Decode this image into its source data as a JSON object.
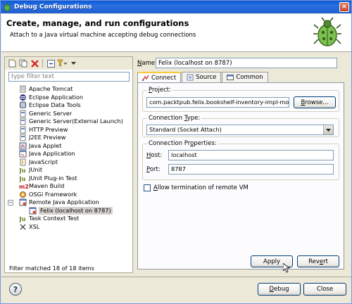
{
  "window": {
    "title": "Debug Configurations",
    "close_symbol": "×"
  },
  "header": {
    "title": "Create, manage, and run configurations",
    "description": "Attach to a Java virtual machine accepting debug connections"
  },
  "left": {
    "filter_placeholder": "type filter text",
    "tree": [
      {
        "label": "Apache Tomcat",
        "icon": "tomcat-icon"
      },
      {
        "label": "Eclipse Application",
        "icon": "eclipse-icon"
      },
      {
        "label": "Eclipse Data Tools",
        "icon": "data-tools-icon"
      },
      {
        "label": "Generic Server",
        "icon": "server-icon"
      },
      {
        "label": "Generic Server(External Launch)",
        "icon": "server-icon"
      },
      {
        "label": "HTTP Preview",
        "icon": "server-icon"
      },
      {
        "label": "J2EE Preview",
        "icon": "server-icon"
      },
      {
        "label": "Java Applet",
        "icon": "applet-icon"
      },
      {
        "label": "Java Application",
        "icon": "java-app-icon"
      },
      {
        "label": "JavaScript",
        "icon": "javascript-icon"
      },
      {
        "label": "JUnit",
        "icon": "junit-icon",
        "icon_text": "Ju"
      },
      {
        "label": "JUnit Plug-in Test",
        "icon": "junit-plugin-icon",
        "icon_text": "Ju"
      },
      {
        "label": "Maven Build",
        "icon": "maven-icon",
        "icon_text": "m2"
      },
      {
        "label": "OSGi Framework",
        "icon": "osgi-icon"
      },
      {
        "label": "Remote Java Application",
        "icon": "remote-java-icon",
        "expanded": true,
        "expander": "−"
      },
      {
        "label": "Felix (localhost on 8787)",
        "icon": "remote-java-icon",
        "child": true,
        "selected": true
      },
      {
        "label": "Task Context Test",
        "icon": "junit-icon",
        "icon_text": "Ju"
      },
      {
        "label": "XSL",
        "icon": "xsl-icon"
      }
    ],
    "status": "Filter matched 18 of 18 items"
  },
  "right": {
    "name_label": "Name:",
    "name_value": "Felix (localhost on 8787)",
    "tabs": [
      {
        "label": "Connect",
        "icon": "connect-icon",
        "active": true
      },
      {
        "label": "Source",
        "icon": "source-icon",
        "active": false
      },
      {
        "label": "Common",
        "icon": "common-icon",
        "active": false
      }
    ],
    "project": {
      "label": "Project:",
      "value": "com.packtpub.felix.bookshelf-inventory-impl-mock",
      "browse": "Browse..."
    },
    "connection_type": {
      "label": "Connection Type:",
      "selected": "Standard (Socket Attach)"
    },
    "connection_properties": {
      "label": "Connection Properties:",
      "host_label": "Host:",
      "host_value": "localhost",
      "port_label": "Port:",
      "port_value": "8787"
    },
    "allow_termination": {
      "label": "Allow termination of remote VM",
      "checked": false
    },
    "apply": "Apply",
    "revert": "Revert"
  },
  "footer": {
    "help_symbol": "?",
    "debug": "Debug",
    "close": "Close"
  },
  "colors": {
    "titlebar": "#0a5ad6",
    "dialog_bg": "#ece9d8",
    "selected_row": "#d6d3ce",
    "tab_highlight": "#ffc83c"
  }
}
